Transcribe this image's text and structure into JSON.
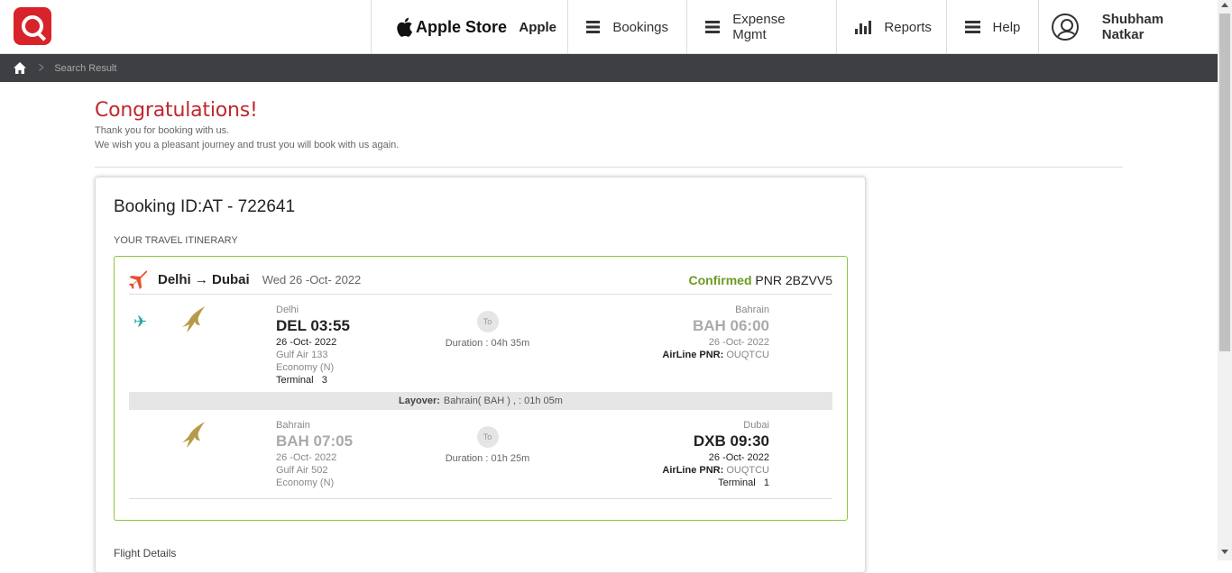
{
  "header": {
    "store_brand": "Apple Store",
    "store_name": "Apple",
    "nav": [
      {
        "label": "Bookings",
        "icon": "menu-icon"
      },
      {
        "label": "Expense Mgmt",
        "icon": "menu-icon"
      },
      {
        "label": "Reports",
        "icon": "bar-chart-icon"
      },
      {
        "label": "Help",
        "icon": "menu-icon"
      }
    ],
    "user_name": "Shubham Natkar"
  },
  "breadcrumb": {
    "current": "Search Result"
  },
  "message": {
    "title": "Congratulations!",
    "line1": "Thank you for booking with us.",
    "line2": "We wish you a pleasant journey and trust you will book with us again."
  },
  "booking": {
    "id_label": "Booking ID:AT - 722641",
    "itinerary_label": "YOUR TRAVEL ITINERARY",
    "route": "Delhi → Dubai",
    "date": "Wed 26 -Oct- 2022",
    "status": "Confirmed",
    "pnr": "PNR 2BZVV5",
    "segments": [
      {
        "dep_city": "Delhi",
        "dep_code_time": "DEL 03:55",
        "dep_date": "26 -Oct- 2022",
        "flight": "Gulf Air 133",
        "cabin": "Economy (N)",
        "dep_terminal": "Terminal   3",
        "to_label": "To",
        "duration": "Duration : 04h 35m",
        "arr_city": "Bahrain",
        "arr_code_time": "BAH 06:00",
        "arr_date": "26 -Oct- 2022",
        "airline_pnr_label": "AirLine PNR:",
        "airline_pnr": "OUQTCU"
      },
      {
        "dep_city": "Bahrain",
        "dep_code_time": "BAH 07:05",
        "dep_date": "26 -Oct- 2022",
        "flight": "Gulf Air 502",
        "cabin": "Economy (N)",
        "to_label": "To",
        "duration": "Duration : 01h 25m",
        "arr_city": "Dubai",
        "arr_code_time": "DXB 09:30",
        "arr_date": "26 -Oct- 2022",
        "airline_pnr_label": "AirLine PNR:",
        "airline_pnr": "OUQTCU",
        "arr_terminal": "Terminal   1"
      }
    ],
    "layover_label": "Layover:",
    "layover_text": "Bahrain( BAH ) , : 01h 05m",
    "flight_details_label": "Flight Details"
  },
  "colors": {
    "brand": "#d8232a",
    "confirmed": "#6b9b21",
    "itinerary_border": "#8cc63f",
    "breadcrumb_bg": "#3d3f42"
  }
}
